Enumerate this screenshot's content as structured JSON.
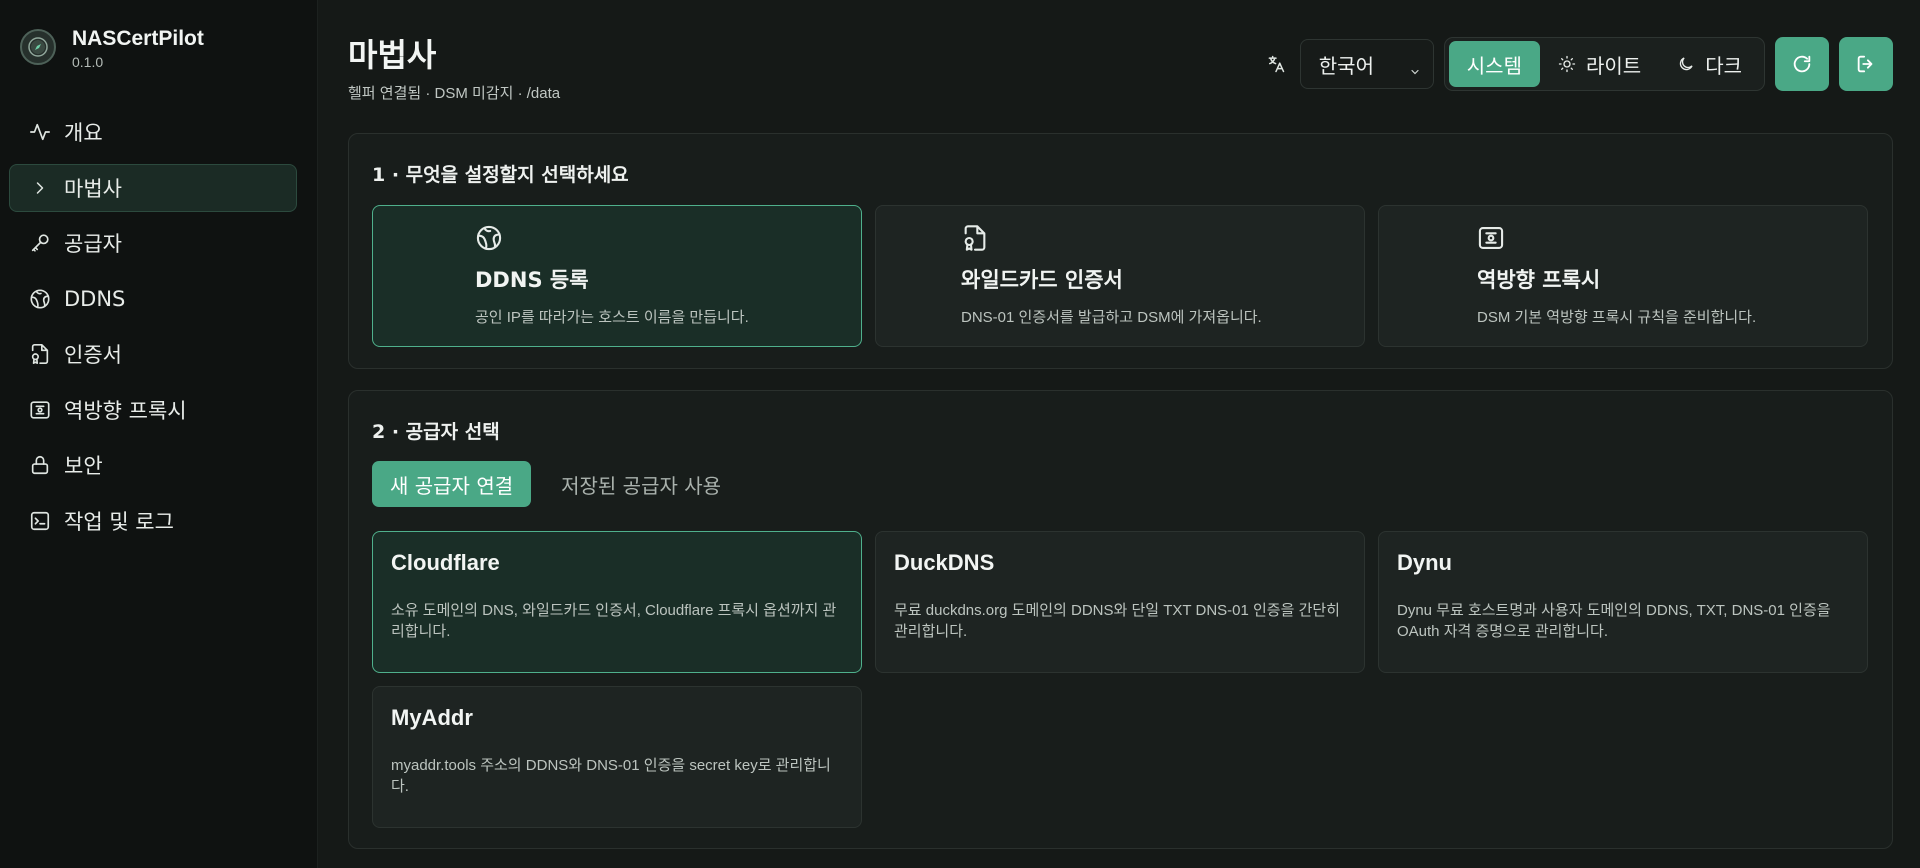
{
  "brand": {
    "name": "NASCertPilot",
    "version": "0.1.0",
    "logo_icon": "compass-logo-icon"
  },
  "sidebar": {
    "items": [
      {
        "label": "개요",
        "icon": "activity-icon",
        "active": false
      },
      {
        "label": "마법사",
        "icon": "chevron-right-icon",
        "active": true
      },
      {
        "label": "공급자",
        "icon": "key-icon",
        "active": false
      },
      {
        "label": "DDNS",
        "icon": "globe-icon",
        "active": false
      },
      {
        "label": "인증서",
        "icon": "file-cert-icon",
        "active": false
      },
      {
        "label": "역방향 프록시",
        "icon": "proxy-icon",
        "active": false
      },
      {
        "label": "보안",
        "icon": "lock-icon",
        "active": false
      },
      {
        "label": "작업 및 로그",
        "icon": "terminal-icon",
        "active": false
      }
    ]
  },
  "header": {
    "title": "마법사",
    "subtitle": "헬퍼 연결됨 · DSM 미감지 · /data"
  },
  "toolbar": {
    "language": "한국어",
    "theme_options": [
      {
        "label": "시스템",
        "icon": "",
        "active": true
      },
      {
        "label": "라이트",
        "icon": "sun-icon",
        "active": false
      },
      {
        "label": "다크",
        "icon": "moon-icon",
        "active": false
      }
    ],
    "refresh_icon": "refresh-icon",
    "logout_icon": "logout-icon"
  },
  "step1": {
    "title": "1 · 무엇을 설정할지 선택하세요",
    "cards": [
      {
        "title": "DDNS 등록",
        "desc": "공인 IP를 따라가는 호스트 이름을 만듭니다.",
        "icon": "globe-icon",
        "selected": true
      },
      {
        "title": "와일드카드 인증서",
        "desc": "DNS-01 인증서를 발급하고 DSM에 가져옵니다.",
        "icon": "file-cert-icon",
        "selected": false
      },
      {
        "title": "역방향 프록시",
        "desc": "DSM 기본 역방향 프록시 규칙을 준비합니다.",
        "icon": "proxy-icon",
        "selected": false
      }
    ]
  },
  "step2": {
    "title": "2 · 공급자 선택",
    "tabs": [
      {
        "label": "새 공급자 연결",
        "active": true
      },
      {
        "label": "저장된 공급자 사용",
        "active": false
      }
    ],
    "providers": [
      {
        "name": "Cloudflare",
        "desc": "소유 도메인의 DNS, 와일드카드 인증서, Cloudflare 프록시 옵션까지 관리합니다.",
        "selected": true
      },
      {
        "name": "DuckDNS",
        "desc": "무료 duckdns.org 도메인의 DDNS와 단일 TXT DNS-01 인증을 간단히 관리합니다.",
        "selected": false
      },
      {
        "name": "Dynu",
        "desc": "Dynu 무료 호스트명과 사용자 도메인의 DDNS, TXT, DNS-01 인증을 OAuth 자격 증명으로 관리합니다.",
        "selected": false
      },
      {
        "name": "MyAddr",
        "desc": "myaddr.tools 주소의 DDNS와 DNS-01 인증을 secret key로 관리합니다.",
        "selected": false
      }
    ]
  }
}
